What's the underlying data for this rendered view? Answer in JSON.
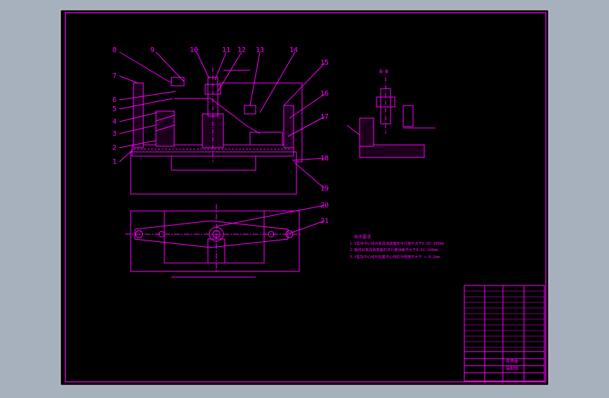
{
  "app": {
    "background": "#a7b0bd",
    "sheet_color": "#000000",
    "line_color": "#ff00ff"
  },
  "drawing": {
    "callouts": [
      {
        "label": "8"
      },
      {
        "label": "9"
      },
      {
        "label": "10"
      },
      {
        "label": "11"
      },
      {
        "label": "12"
      },
      {
        "label": "13"
      },
      {
        "label": "14"
      },
      {
        "label": "7"
      },
      {
        "label": "6"
      },
      {
        "label": "5"
      },
      {
        "label": "4"
      },
      {
        "label": "3"
      },
      {
        "label": "2"
      },
      {
        "label": "1"
      },
      {
        "label": "15"
      },
      {
        "label": "16"
      },
      {
        "label": "17"
      },
      {
        "label": "18"
      },
      {
        "label": "19"
      },
      {
        "label": "20"
      },
      {
        "label": "21"
      }
    ],
    "section_label": "B-B",
    "notes": {
      "title": "技术要求",
      "lines": [
        "1.V型块中心线对夹具体底面的平行度不大于0.05:100mm",
        "2.轴线对夹具体底面的平行度误差不大于0.02:100mm",
        "3.V型块中心线与钻套中心线的对称度不大于 +-0.2mm"
      ]
    },
    "title_block": {
      "part_name": "夹具体",
      "drawing_name": "装配图"
    }
  }
}
